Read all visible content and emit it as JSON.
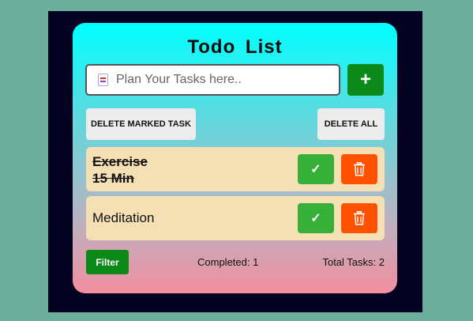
{
  "title": "Todo  List",
  "input": {
    "placeholder": "Plan Your Tasks here..",
    "value": "",
    "icon": "notepad-icon"
  },
  "add_button": {
    "label": "+"
  },
  "actions": {
    "delete_marked": "DELETE MARKED TASK",
    "delete_all": "DELETE ALL"
  },
  "tasks": [
    {
      "line1": "Exercise",
      "line2": "15 Min",
      "completed": true
    },
    {
      "line1": "Meditation",
      "line2": "",
      "completed": false
    }
  ],
  "task_buttons": {
    "check_icon": "check-icon",
    "delete_icon": "trash-icon",
    "check_glyph": "✓"
  },
  "footer": {
    "filter": "Filter",
    "completed": "Completed: 1",
    "total": "Total Tasks: 2"
  },
  "colors": {
    "background": "#6aae9b",
    "frame": "#030321",
    "gradient_top": "#00ffff",
    "gradient_bottom": "#f28f9f",
    "green": "#0c8a19",
    "check_green": "#37b03a",
    "delete_orange": "#ff5200",
    "task_bg": "#f5dfb4"
  }
}
